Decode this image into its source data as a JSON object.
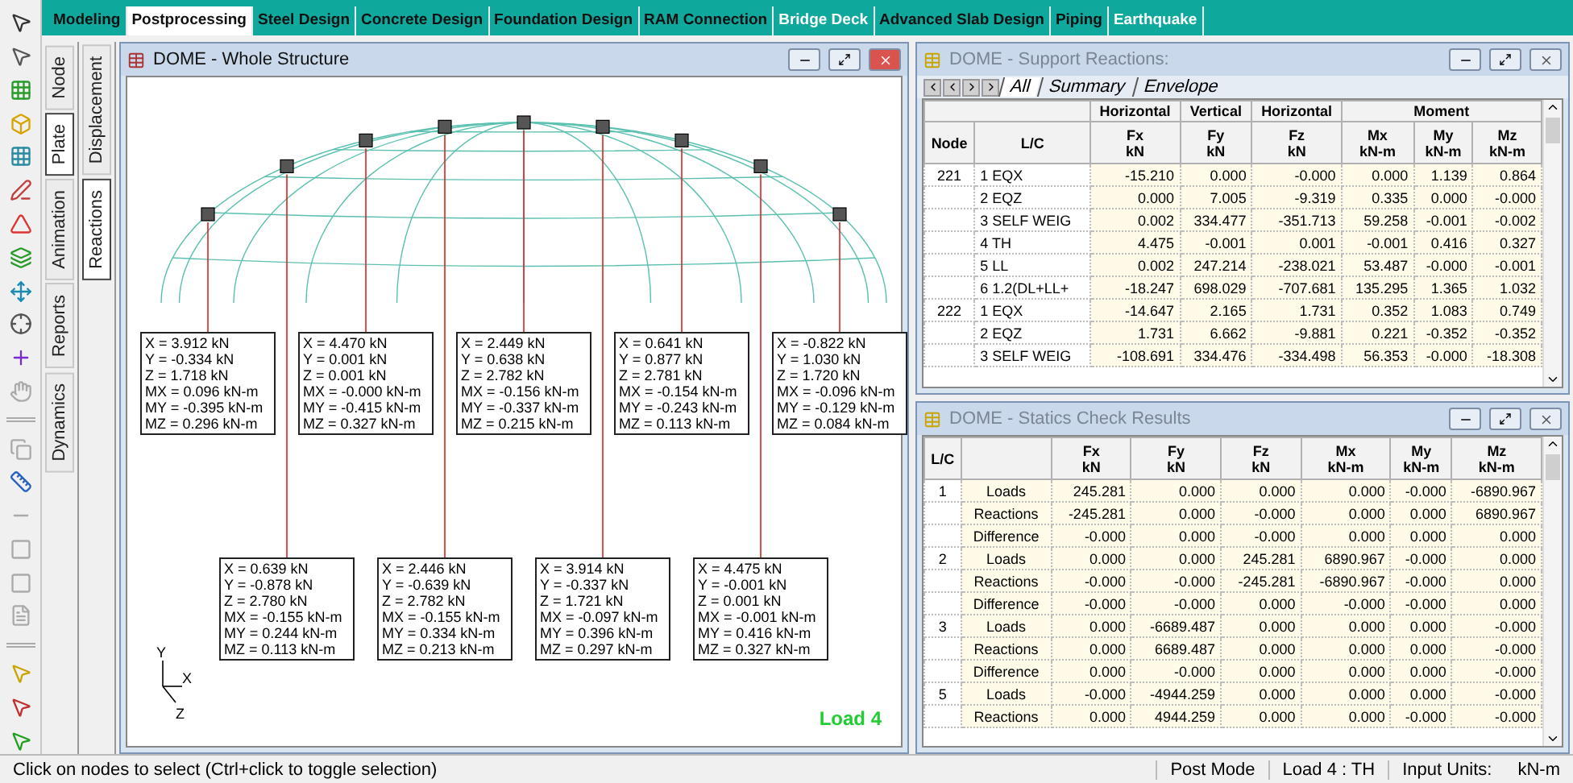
{
  "top_tabs": [
    {
      "label": "Modeling",
      "selected": false,
      "disabled": false
    },
    {
      "label": "Postprocessing",
      "selected": true,
      "disabled": false
    },
    {
      "label": "Steel Design",
      "selected": false,
      "disabled": false
    },
    {
      "label": "Concrete Design",
      "selected": false,
      "disabled": false
    },
    {
      "label": "Foundation Design",
      "selected": false,
      "disabled": false
    },
    {
      "label": "RAM Connection",
      "selected": false,
      "disabled": false
    },
    {
      "label": "Bridge Deck",
      "selected": false,
      "disabled": true
    },
    {
      "label": "Advanced Slab Design",
      "selected": false,
      "disabled": false
    },
    {
      "label": "Piping",
      "selected": false,
      "disabled": false
    },
    {
      "label": "Earthquake",
      "selected": false,
      "disabled": true
    }
  ],
  "side_tabs": [
    {
      "label": "Node",
      "selected": false
    },
    {
      "label": "Plate",
      "selected": true
    },
    {
      "label": "Animation",
      "selected": false
    },
    {
      "label": "Reports",
      "selected": false
    },
    {
      "label": "Dynamics",
      "selected": false
    }
  ],
  "sub_tabs": [
    {
      "label": "Displacement",
      "selected": false
    },
    {
      "label": "Reactions",
      "selected": true
    }
  ],
  "structure_window": {
    "title": "DOME - Whole Structure",
    "load_label": "Load 4",
    "axes": [
      "Y",
      "X",
      "Z"
    ],
    "reaction_labels": [
      {
        "lines": [
          "X = 3.912 kN",
          "Y = -0.334 kN",
          "Z = 1.718 kN",
          "MX = 0.096 kN-m",
          "MY = -0.395 kN-m",
          "MZ = 0.296 kN-m"
        ]
      },
      {
        "lines": [
          "X = 4.470 kN",
          "Y = 0.001 kN",
          "Z = 0.001 kN",
          "MX = -0.000 kN-m",
          "MY = -0.415 kN-m",
          "MZ = 0.327 kN-m"
        ]
      },
      {
        "lines": [
          "X = 2.449 kN",
          "Y = 0.638 kN",
          "Z = 2.782 kN",
          "MX = -0.156 kN-m",
          "MY = -0.337 kN-m",
          "MZ = 0.215 kN-m"
        ]
      },
      {
        "lines": [
          "X = 0.641 kN",
          "Y = 0.877 kN",
          "Z = 2.781 kN",
          "MX = -0.154 kN-m",
          "MY = -0.243 kN-m",
          "MZ = 0.113 kN-m"
        ]
      },
      {
        "lines": [
          "X = -0.822 kN",
          "Y = 1.030 kN",
          "Z = 1.720 kN",
          "MX = -0.096 kN-m",
          "MY = -0.129 kN-m",
          "MZ = 0.084 kN-m"
        ]
      },
      {
        "lines": [
          "X = 0.639 kN",
          "Y = -0.878 kN",
          "Z = 2.780 kN",
          "MX = -0.155 kN-m",
          "MY = 0.244 kN-m",
          "MZ = 0.113 kN-m"
        ]
      },
      {
        "lines": [
          "X = 2.446 kN",
          "Y = -0.639 kN",
          "Z = 2.782 kN",
          "MX = -0.155 kN-m",
          "MY = 0.334 kN-m",
          "MZ = 0.213 kN-m"
        ]
      },
      {
        "lines": [
          "X = 3.914 kN",
          "Y = -0.337 kN",
          "Z = 1.721 kN",
          "MX = -0.097 kN-m",
          "MY = 0.396 kN-m",
          "MZ = 0.297 kN-m"
        ]
      },
      {
        "lines": [
          "X = 4.475 kN",
          "Y = -0.001 kN",
          "Z = 0.001 kN",
          "MX = -0.001 kN-m",
          "MY = 0.416 kN-m",
          "MZ = 0.327 kN-m"
        ]
      }
    ]
  },
  "support_reactions": {
    "title": "DOME - Support Reactions:",
    "tabs": [
      {
        "label": "All",
        "selected": true
      },
      {
        "label": "Summary",
        "selected": false
      },
      {
        "label": "Envelope",
        "selected": false
      }
    ],
    "group_headers": [
      "Horizontal",
      "Vertical",
      "Horizontal",
      "Moment"
    ],
    "columns": [
      {
        "name": "Node"
      },
      {
        "name": "L/C"
      },
      {
        "name": "Fx",
        "unit": "kN"
      },
      {
        "name": "Fy",
        "unit": "kN"
      },
      {
        "name": "Fz",
        "unit": "kN"
      },
      {
        "name": "Mx",
        "unit": "kN-m"
      },
      {
        "name": "My",
        "unit": "kN-m"
      },
      {
        "name": "Mz",
        "unit": "kN-m"
      }
    ],
    "rows": [
      {
        "node": "221",
        "lc": "1 EQX",
        "values": [
          "-15.210",
          "0.000",
          "-0.000",
          "0.000",
          "1.139",
          "0.864"
        ]
      },
      {
        "lc": "2 EQZ",
        "values": [
          "0.000",
          "7.005",
          "-9.319",
          "0.335",
          "0.000",
          "-0.000"
        ]
      },
      {
        "lc": "3 SELF WEIG",
        "values": [
          "0.002",
          "334.477",
          "-351.713",
          "59.258",
          "-0.001",
          "-0.002"
        ]
      },
      {
        "lc": "4 TH",
        "values": [
          "4.475",
          "-0.001",
          "0.001",
          "-0.001",
          "0.416",
          "0.327"
        ]
      },
      {
        "lc": "5 LL",
        "values": [
          "0.002",
          "247.214",
          "-238.021",
          "53.487",
          "-0.000",
          "-0.001"
        ]
      },
      {
        "lc": "6 1.2(DL+LL+",
        "values": [
          "-18.247",
          "698.029",
          "-707.681",
          "135.295",
          "1.365",
          "1.032"
        ]
      },
      {
        "node": "222",
        "lc": "1 EQX",
        "values": [
          "-14.647",
          "2.165",
          "1.731",
          "0.352",
          "1.083",
          "0.749"
        ]
      },
      {
        "lc": "2 EQZ",
        "values": [
          "1.731",
          "6.662",
          "-9.881",
          "0.221",
          "-0.352",
          "-0.352"
        ]
      },
      {
        "lc": "3 SELF WEIG",
        "values": [
          "-108.691",
          "334.476",
          "-334.498",
          "56.353",
          "-0.000",
          "-18.308"
        ]
      }
    ]
  },
  "statics_check": {
    "title": "DOME - Statics Check Results",
    "columns": [
      {
        "name": "L/C"
      },
      {},
      {
        "name": "Fx",
        "unit": "kN"
      },
      {
        "name": "Fy",
        "unit": "kN"
      },
      {
        "name": "Fz",
        "unit": "kN"
      },
      {
        "name": "Mx",
        "unit": "kN-m"
      },
      {
        "name": "My",
        "unit": "kN-m"
      },
      {
        "name": "Mz",
        "unit": "kN-m"
      }
    ],
    "rows": [
      {
        "lc": "1",
        "type": "Loads",
        "values": [
          "245.281",
          "0.000",
          "0.000",
          "0.000",
          "-0.000",
          "-6890.967"
        ]
      },
      {
        "type": "Reactions",
        "values": [
          "-245.281",
          "0.000",
          "-0.000",
          "0.000",
          "0.000",
          "6890.967"
        ]
      },
      {
        "type": "Difference",
        "values": [
          "-0.000",
          "0.000",
          "-0.000",
          "0.000",
          "0.000",
          "0.000"
        ]
      },
      {
        "lc": "2",
        "type": "Loads",
        "values": [
          "0.000",
          "0.000",
          "245.281",
          "6890.967",
          "-0.000",
          "0.000"
        ]
      },
      {
        "type": "Reactions",
        "values": [
          "-0.000",
          "-0.000",
          "-245.281",
          "-6890.967",
          "-0.000",
          "0.000"
        ]
      },
      {
        "type": "Difference",
        "values": [
          "-0.000",
          "-0.000",
          "0.000",
          "-0.000",
          "-0.000",
          "0.000"
        ]
      },
      {
        "lc": "3",
        "type": "Loads",
        "values": [
          "0.000",
          "-6689.487",
          "0.000",
          "0.000",
          "0.000",
          "-0.000"
        ]
      },
      {
        "type": "Reactions",
        "values": [
          "0.000",
          "6689.487",
          "0.000",
          "0.000",
          "0.000",
          "-0.000"
        ]
      },
      {
        "type": "Difference",
        "values": [
          "0.000",
          "-0.000",
          "0.000",
          "0.000",
          "0.000",
          "-0.000"
        ]
      },
      {
        "lc": "5",
        "type": "Loads",
        "values": [
          "-0.000",
          "-4944.259",
          "0.000",
          "0.000",
          "0.000",
          "-0.000"
        ]
      },
      {
        "type": "Reactions",
        "values": [
          "0.000",
          "4944.259",
          "0.000",
          "0.000",
          "-0.000",
          "-0.000"
        ]
      }
    ]
  },
  "status_bar": {
    "hint": "Click on nodes to select (Ctrl+click to toggle selection)",
    "mode": "Post Mode",
    "load": "Load 4 : TH",
    "units_label": "Input Units:",
    "units": "kN-m"
  }
}
